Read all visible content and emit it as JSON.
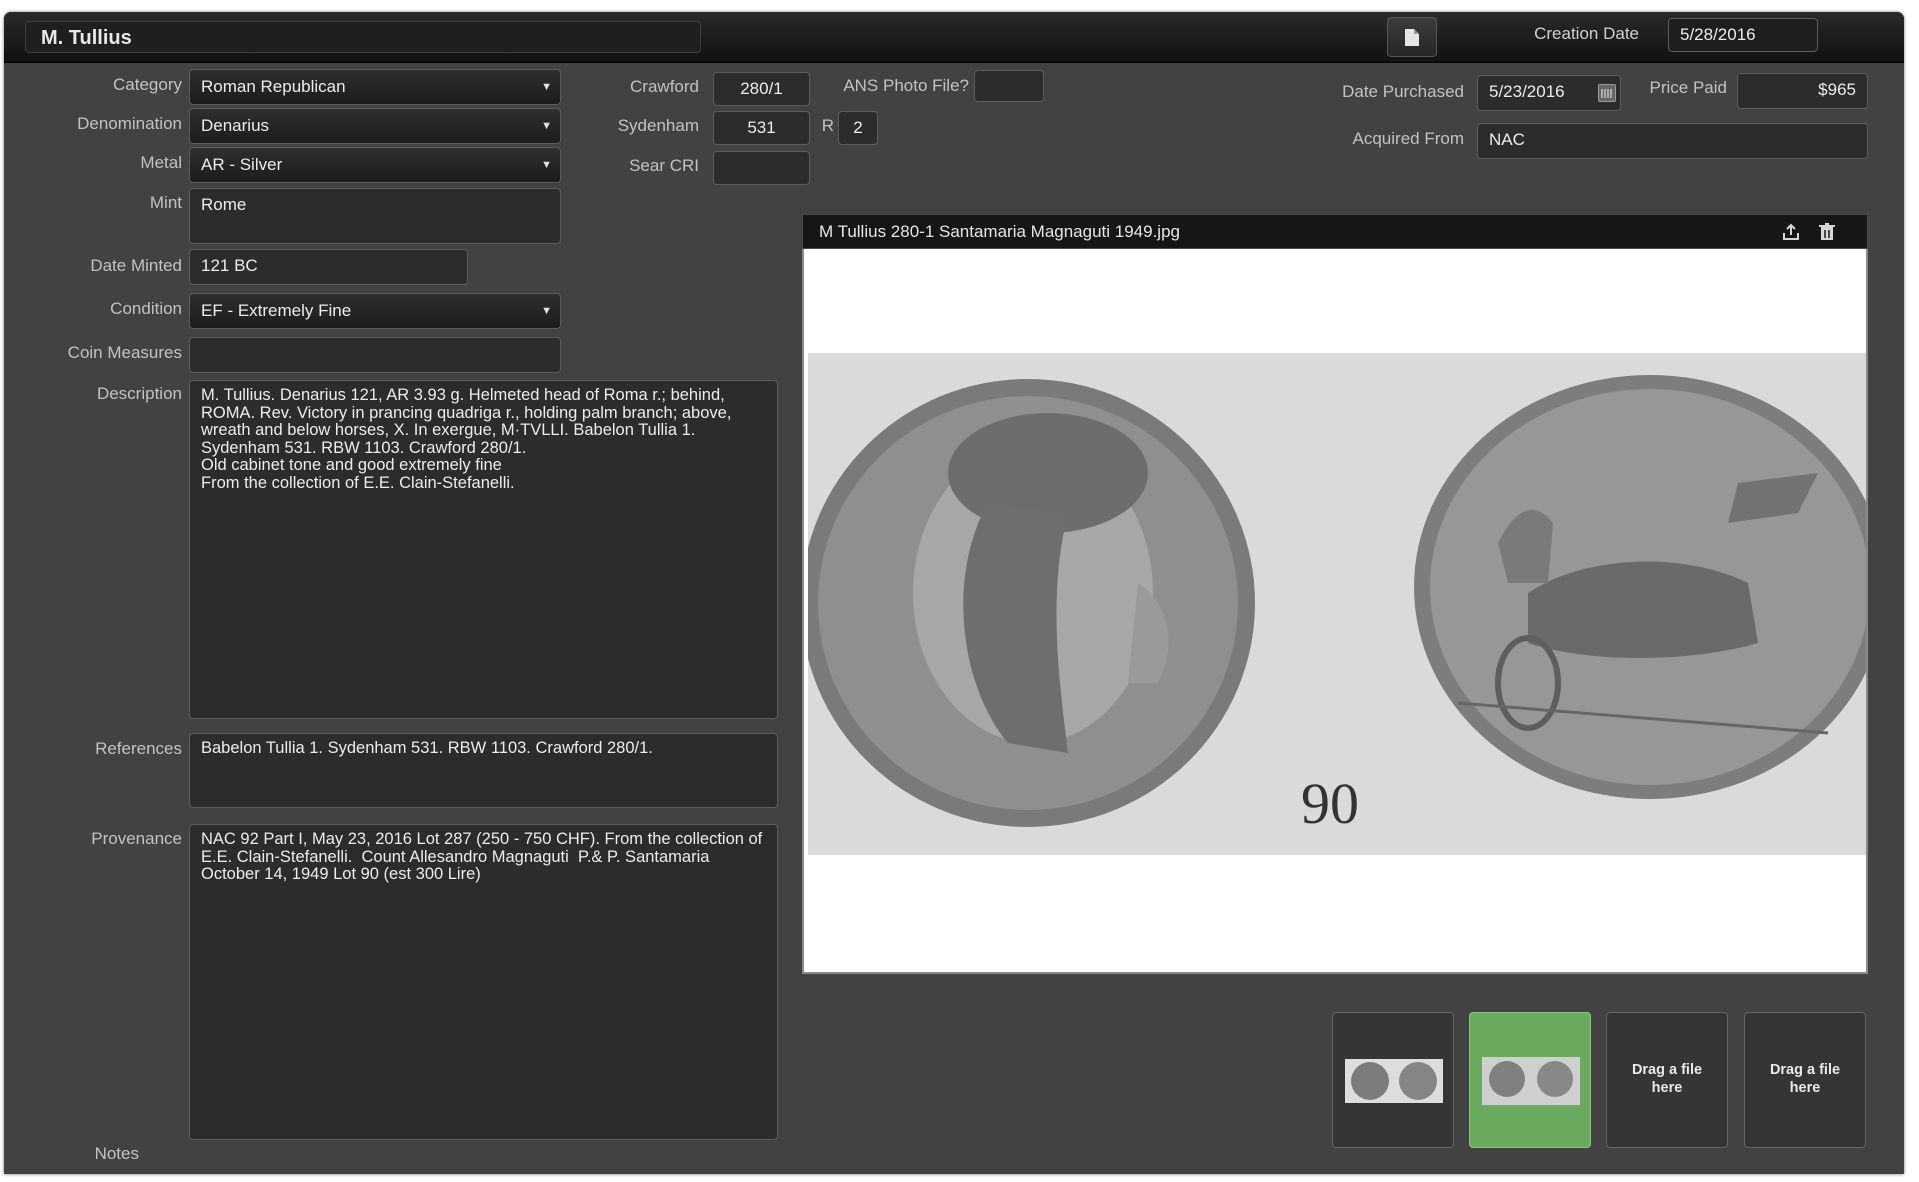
{
  "record": {
    "title": "M. Tullius"
  },
  "header": {
    "creation_date_label": "Creation Date",
    "creation_date": "5/28/2016"
  },
  "left": {
    "category_label": "Category",
    "category": "Roman Republican",
    "denomination_label": "Denomination",
    "denomination": "Denarius",
    "metal_label": "Metal",
    "metal": "AR - Silver",
    "mint_label": "Mint",
    "mint": "Rome",
    "date_minted_label": "Date Minted",
    "date_minted": "121 BC",
    "condition_label": "Condition",
    "condition": "EF - Extremely Fine",
    "coin_measures_label": "Coin Measures",
    "coin_measures": "",
    "description_label": "Description",
    "description": "M. Tullius. Denarius 121, AR 3.93 g. Helmeted head of Roma r.; behind, ROMA. Rev. Victory in prancing quadriga r., holding palm branch; above, wreath and below horses, X. In exergue, M·TVLLI. Babelon Tullia 1. Sydenham 531. RBW 1103. Crawford 280/1.\nOld cabinet tone and good extremely fine\nFrom the collection of E.E. Clain-Stefanelli.",
    "references_label": "References",
    "references": "Babelon Tullia 1. Sydenham 531. RBW 1103. Crawford 280/1.",
    "provenance_label": "Provenance",
    "provenance": "NAC 92 Part I, May 23, 2016 Lot 287 (250 - 750 CHF). From the collection of E.E. Clain-Stefanelli.  Count Allesandro Magnaguti  P.& P. Santamaria October 14, 1949 Lot 90 (est 300 Lire)",
    "notes_label": "Notes"
  },
  "middle": {
    "crawford_label": "Crawford",
    "crawford": "280/1",
    "sydenham_label": "Sydenham",
    "sydenham": "531",
    "rarity_label": "R",
    "rarity": "2",
    "sear_label": "Sear CRI",
    "sear": "",
    "ans_label": "ANS Photo File?",
    "ans": ""
  },
  "right": {
    "date_purchased_label": "Date Purchased",
    "date_purchased": "5/23/2016",
    "price_paid_label": "Price Paid",
    "price_paid": "$965",
    "acquired_from_label": "Acquired From",
    "acquired_from": "NAC"
  },
  "viewer": {
    "filename": "M Tullius 280-1 Santamaria Magnaguti 1949.jpg",
    "photo_caption": "90"
  },
  "thumbnails": {
    "drop_label_1": "Drag a file here",
    "drop_label_2": "Drag a file here"
  },
  "icons": [
    "document-icon",
    "calendar-icon",
    "export-icon",
    "trash-icon",
    "dropdown-arrow-icon"
  ]
}
